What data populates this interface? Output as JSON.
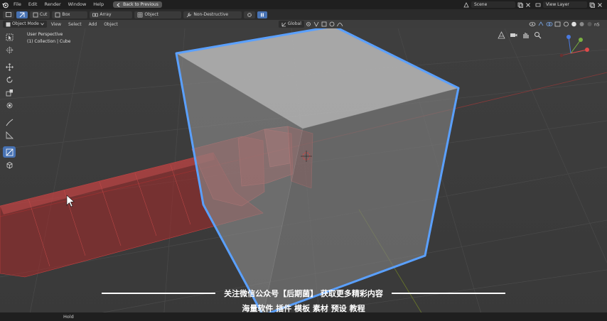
{
  "menubar": {
    "items": [
      "File",
      "Edit",
      "Render",
      "Window",
      "Help"
    ],
    "back_button": "Back to Previous",
    "scene": "Scene",
    "view_layer": "View Layer"
  },
  "tool_header": {
    "cut": "Cut",
    "box": "Box",
    "array": "Array",
    "object": "Object",
    "non_destructive": "Non-Destructive"
  },
  "view_header": {
    "mode": "Object Mode",
    "items": [
      "View",
      "Select",
      "Add",
      "Object"
    ],
    "orientation": "Global"
  },
  "viewport": {
    "perspective": "User Perspective",
    "collection": "(1) Collection | Cube"
  },
  "subtitle": {
    "line1": "关注微信公众号【后期菌】 获取更多精彩内容",
    "line2": "海量软件 插件 模板 素材 预设 教程"
  },
  "status": {
    "hint": "Hold"
  },
  "colors": {
    "accent": "#4772b3",
    "selection_outline": "#5aa0ff",
    "cutter": "#c83232",
    "background": "#3d3d3d"
  }
}
